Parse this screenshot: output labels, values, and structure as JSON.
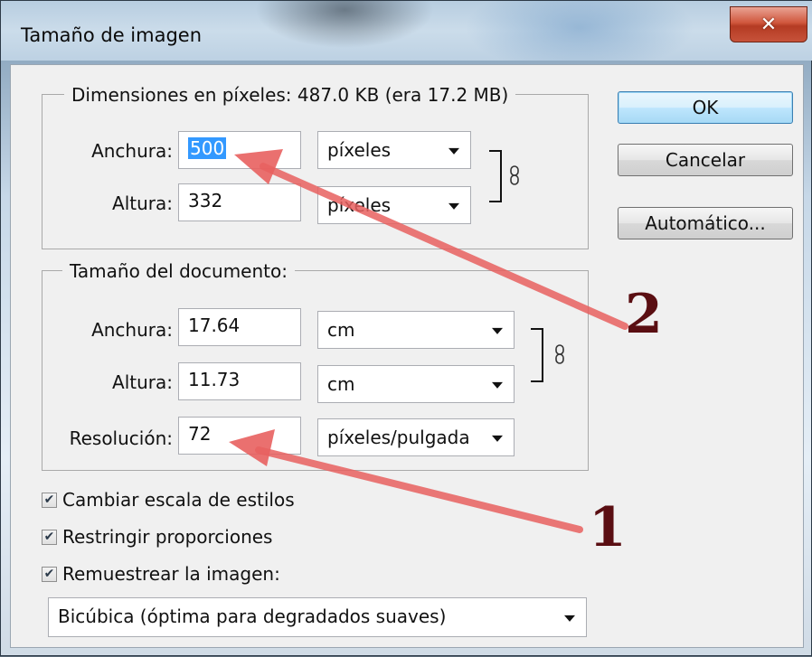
{
  "window": {
    "title": "Tamaño de imagen",
    "close_glyph": "✕"
  },
  "pixel_dimensions": {
    "legend": "Dimensiones en píxeles: 487.0 KB (era 17.2 MB)",
    "width_label": "Anchura:",
    "width_value": "500",
    "width_unit": "píxeles",
    "height_label": "Altura:",
    "height_value": "332",
    "height_unit": "píxeles"
  },
  "document_size": {
    "legend": "Tamaño del documento:",
    "width_label": "Anchura:",
    "width_value": "17.64",
    "width_unit": "cm",
    "height_label": "Altura:",
    "height_value": "11.73",
    "height_unit": "cm",
    "resolution_label": "Resolución:",
    "resolution_value": "72",
    "resolution_unit": "píxeles/pulgada"
  },
  "buttons": {
    "ok": "OK",
    "cancel": "Cancelar",
    "auto": "Automático..."
  },
  "checkboxes": [
    {
      "label": "Cambiar escala de estilos",
      "checked": true
    },
    {
      "label": "Restringir proporciones",
      "checked": true
    },
    {
      "label": "Remuestrear la imagen:",
      "checked": true
    }
  ],
  "resample": {
    "value": "Bicúbica (óptima para degradados suaves)"
  },
  "annotations": {
    "one": "1",
    "two": "2",
    "arrow_color": "#e8605f"
  },
  "icons": {
    "dropdown": "chevron-down-icon",
    "chain": "link-chain-icon",
    "check": "check-icon"
  }
}
